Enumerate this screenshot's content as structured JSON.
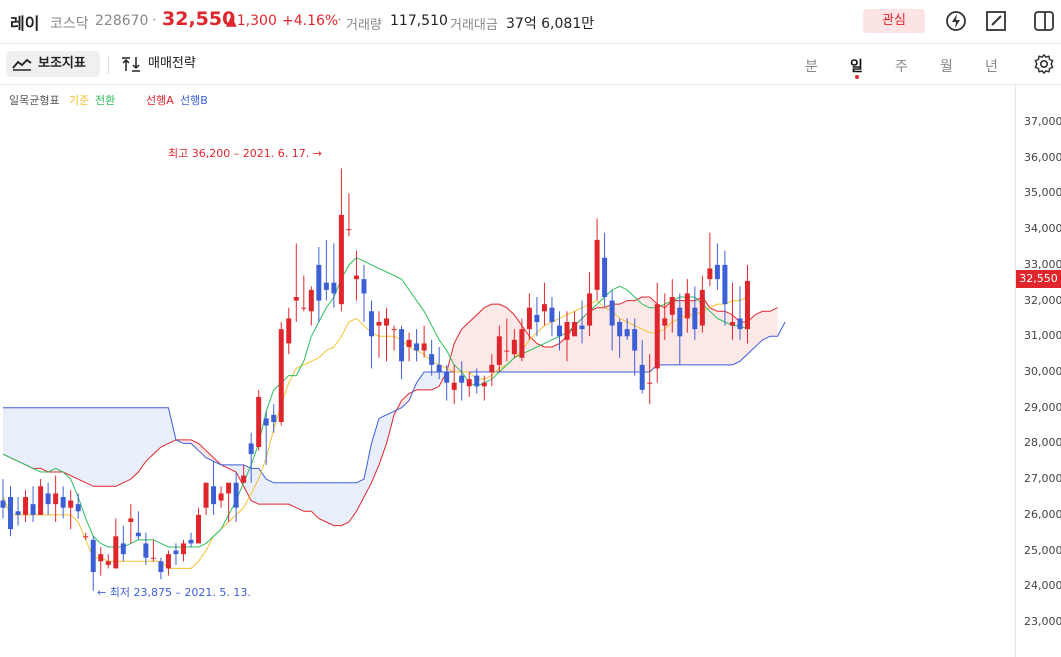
{
  "header": {
    "name": "레이",
    "market": "코스닥",
    "code": "228670",
    "dot": "·",
    "price": "32,550",
    "change": "▲1,300",
    "change_pct": "+4.16%",
    "volume_label": "거래량",
    "volume": "117,510",
    "amount_label": "거래대금",
    "amount": "37억 6,081만",
    "fav_label": "관심",
    "icons": [
      "lightning-icon",
      "edit-icon",
      "panel-icon"
    ]
  },
  "toolbar": {
    "indicator_label": "보조지표",
    "strategy_label": "매매전략",
    "periods": [
      "분",
      "일",
      "주",
      "월",
      "년"
    ],
    "active_period": "일"
  },
  "legend": {
    "title": "일목균형표",
    "base": "기준",
    "conv": "전환",
    "span_a": "선행A",
    "span_b": "선행B"
  },
  "annotations": {
    "high": "최고 36,200 – 2021. 6. 17. →",
    "low": "← 최저 23,875 – 2021. 5. 13."
  },
  "colors": {
    "up": "#e0262d",
    "down": "#3d5fd6",
    "base": "#f2c233",
    "conv": "#2dbf5c",
    "span_a": "#e0262d",
    "span_b": "#3d5fd6",
    "cloud_bull": "#fde8e8",
    "cloud_bear": "#e9eefb"
  },
  "chart_data": {
    "type": "candlestick",
    "indicator": "ichimoku",
    "ylim": [
      22500,
      38000
    ],
    "y_ticks": [
      "37,000",
      "36,000",
      "35,000",
      "34,000",
      "33,000",
      "32,000",
      "31,000",
      "30,000",
      "29,000",
      "28,000",
      "27,000",
      "26,000",
      "25,000",
      "24,000",
      "23,000"
    ],
    "last_price_label": "32,550",
    "candles": [
      [
        26400,
        27000,
        25900,
        26200
      ],
      [
        26500,
        26800,
        25400,
        25600
      ],
      [
        26100,
        26500,
        25700,
        26000
      ],
      [
        26000,
        26700,
        25800,
        26500
      ],
      [
        26300,
        26800,
        25800,
        26000
      ],
      [
        26000,
        27000,
        26000,
        26800
      ],
      [
        26600,
        26900,
        26000,
        26300
      ],
      [
        26300,
        27100,
        25800,
        26600
      ],
      [
        26500,
        26800,
        25900,
        26200
      ],
      [
        26200,
        26700,
        25600,
        26400
      ],
      [
        26300,
        26600,
        25900,
        26100
      ],
      [
        25400,
        25500,
        25300,
        25400
      ],
      [
        25300,
        25400,
        23875,
        24400
      ],
      [
        24700,
        25100,
        24300,
        24900
      ],
      [
        24600,
        24900,
        24500,
        24700
      ],
      [
        24500,
        25900,
        24500,
        25400
      ],
      [
        25200,
        25700,
        24700,
        24900
      ],
      [
        25800,
        26300,
        25200,
        25900
      ],
      [
        25500,
        26100,
        25300,
        25400
      ],
      [
        25200,
        25500,
        24600,
        24800
      ],
      [
        24800,
        25300,
        24700,
        24800
      ],
      [
        24700,
        24800,
        24200,
        24400
      ],
      [
        24500,
        25000,
        24300,
        24900
      ],
      [
        25000,
        25200,
        24600,
        24900
      ],
      [
        24900,
        25300,
        24700,
        25200
      ],
      [
        25300,
        25500,
        25100,
        25200
      ],
      [
        25200,
        26200,
        25200,
        26000
      ],
      [
        26200,
        26900,
        26000,
        26900
      ],
      [
        26800,
        27500,
        26000,
        26300
      ],
      [
        26400,
        26800,
        26200,
        26600
      ],
      [
        26600,
        26900,
        25800,
        26900
      ],
      [
        26900,
        27200,
        25800,
        26200
      ],
      [
        26900,
        27400,
        26900,
        27100
      ],
      [
        28000,
        28300,
        26900,
        27700
      ],
      [
        27900,
        29500,
        27800,
        29300
      ],
      [
        28700,
        28900,
        27400,
        28500
      ],
      [
        28800,
        29100,
        28300,
        28600
      ],
      [
        28600,
        31400,
        28500,
        31200
      ],
      [
        30800,
        31800,
        30500,
        31500
      ],
      [
        32000,
        33600,
        31400,
        32100
      ],
      [
        31800,
        32700,
        31700,
        31800
      ],
      [
        31700,
        32400,
        31300,
        32300
      ],
      [
        33000,
        33500,
        31400,
        32000
      ],
      [
        32500,
        33700,
        32000,
        32300
      ],
      [
        32500,
        33600,
        31800,
        32200
      ],
      [
        31900,
        35700,
        31700,
        34400
      ],
      [
        34000,
        35000,
        33800,
        34000
      ],
      [
        32600,
        33400,
        32000,
        32700
      ],
      [
        32600,
        33000,
        31400,
        32200
      ],
      [
        31700,
        32000,
        30100,
        31000
      ],
      [
        31300,
        31700,
        30400,
        31400
      ],
      [
        31300,
        31800,
        30300,
        31500
      ],
      [
        31200,
        31300,
        30600,
        31200
      ],
      [
        31200,
        31300,
        29800,
        30300
      ],
      [
        30700,
        31100,
        30300,
        30900
      ],
      [
        30800,
        31200,
        30300,
        30600
      ],
      [
        30600,
        31300,
        30400,
        30800
      ],
      [
        30500,
        30900,
        29900,
        30200
      ],
      [
        30200,
        30700,
        29800,
        30000
      ],
      [
        30000,
        30200,
        29200,
        29700
      ],
      [
        29500,
        30200,
        29100,
        29700
      ],
      [
        29900,
        30300,
        29200,
        29700
      ],
      [
        29600,
        30000,
        29300,
        29800
      ],
      [
        29900,
        30100,
        29400,
        29600
      ],
      [
        29600,
        29900,
        29200,
        29700
      ],
      [
        30000,
        30500,
        29600,
        30200
      ],
      [
        30200,
        31300,
        30000,
        31000
      ],
      [
        30600,
        31500,
        30300,
        30600
      ],
      [
        30500,
        31200,
        30400,
        30900
      ],
      [
        30400,
        31500,
        30300,
        31200
      ],
      [
        31200,
        32200,
        30900,
        31800
      ],
      [
        31600,
        32100,
        31000,
        31400
      ],
      [
        31700,
        32500,
        31300,
        31900
      ],
      [
        31800,
        32100,
        31000,
        31400
      ],
      [
        31300,
        31700,
        30600,
        31000
      ],
      [
        30900,
        31700,
        30300,
        31400
      ],
      [
        31000,
        31700,
        31000,
        31400
      ],
      [
        31300,
        32000,
        30800,
        31200
      ],
      [
        31300,
        32800,
        31000,
        32200
      ],
      [
        32300,
        34300,
        32000,
        33700
      ],
      [
        33200,
        33900,
        31800,
        32100
      ],
      [
        32000,
        32300,
        30600,
        31300
      ],
      [
        31400,
        31500,
        30400,
        31000
      ],
      [
        31200,
        31500,
        30900,
        31000
      ],
      [
        31200,
        31500,
        29900,
        30600
      ],
      [
        30200,
        30900,
        29400,
        29500
      ],
      [
        29700,
        30500,
        29100,
        29700
      ],
      [
        30100,
        32500,
        29700,
        31900
      ],
      [
        31300,
        32200,
        30900,
        31500
      ],
      [
        31600,
        32600,
        31100,
        32100
      ],
      [
        31800,
        32200,
        30200,
        31000
      ],
      [
        31500,
        32600,
        31100,
        32200
      ],
      [
        31800,
        32400,
        30900,
        31200
      ],
      [
        31300,
        32700,
        31100,
        32300
      ],
      [
        32600,
        33900,
        32400,
        32900
      ],
      [
        33000,
        33600,
        32300,
        32600
      ],
      [
        33000,
        33400,
        31300,
        31900
      ],
      [
        31300,
        32500,
        30900,
        31400
      ],
      [
        31500,
        32400,
        30900,
        31200
      ],
      [
        31200,
        33000,
        30800,
        32550
      ]
    ],
    "kijun": [
      26500,
      26000,
      26000,
      26000,
      26000,
      26000,
      26000,
      26000,
      26000,
      26000,
      25800,
      25300,
      24800,
      24800,
      24700,
      24700,
      24700,
      24700,
      24700,
      24700,
      24700,
      24700,
      24500,
      24500,
      24500,
      24500,
      24700,
      25000,
      25400,
      25600,
      25800,
      26000,
      26200,
      26600,
      27000,
      27600,
      28400,
      29100,
      29700,
      30100,
      30200,
      30300,
      30400,
      30600,
      30700,
      31000,
      31400,
      31500,
      31300,
      31100,
      31000,
      31000,
      31000,
      30900,
      30700,
      30600,
      30500,
      30300,
      30200,
      30100,
      30000,
      30000,
      30000,
      29800,
      29800,
      29900,
      30100,
      30200,
      30400,
      30600,
      30900,
      31100,
      31300,
      31400,
      31500,
      31600,
      31700,
      31800,
      31900,
      32000,
      31800,
      31700,
      31500,
      31400,
      31300,
      31200,
      31100,
      31100,
      31200,
      31400,
      31500,
      31600,
      31600,
      31700,
      31800,
      31900,
      31900,
      32000,
      32000,
      32100
    ],
    "tenkan": [
      27700,
      27600,
      27500,
      27400,
      27300,
      27200,
      27200,
      27300,
      27200,
      27000,
      26500,
      25900,
      25400,
      25200,
      25100,
      25100,
      25100,
      25200,
      25300,
      25300,
      25300,
      25200,
      25100,
      25100,
      25100,
      25100,
      25100,
      25200,
      25400,
      25600,
      26000,
      26400,
      26900,
      27400,
      28000,
      28900,
      29500,
      29700,
      29900,
      29900,
      30300,
      31000,
      31400,
      31800,
      32100,
      32600,
      33000,
      33200,
      33100,
      33000,
      32900,
      32800,
      32700,
      32600,
      32300,
      32000,
      31700,
      31300,
      30900,
      30600,
      30200,
      30000,
      29700,
      29600,
      29700,
      29800,
      30000,
      30200,
      30400,
      30500,
      30600,
      30700,
      30800,
      30900,
      31000,
      31100,
      31300,
      31500,
      31700,
      31900,
      32100,
      32300,
      32400,
      32300,
      32100,
      31900,
      31800,
      31800,
      31900,
      32000,
      32100,
      32100,
      32100,
      31900,
      31700,
      31500,
      31400,
      31300,
      31300,
      31200
    ],
    "span_a_start": 0,
    "span_a": [
      27700,
      27600,
      27500,
      27400,
      27300,
      27300,
      27200,
      27200,
      27200,
      27100,
      27000,
      26900,
      26800,
      26800,
      26800,
      26800,
      26900,
      27000,
      27200,
      27500,
      27700,
      27900,
      28000,
      28100,
      28100,
      28100,
      28000,
      27800,
      27600,
      27400,
      27300,
      27200,
      26800,
      26400,
      26300,
      26300,
      26300,
      26300,
      26300,
      26200,
      26100,
      26100,
      25900,
      25800,
      25700,
      25700,
      25800,
      26100,
      26500,
      26900,
      27400,
      28000,
      28800,
      29200,
      29400,
      29500,
      29500,
      29500,
      29600,
      30000,
      30800,
      31200,
      31400,
      31600,
      31800,
      31900,
      31900,
      31800,
      31600,
      31300,
      31000,
      30800,
      30700,
      30700,
      30800,
      31000,
      31300,
      31500,
      31700,
      31800,
      31800,
      31900,
      31900,
      32000,
      32000,
      32100,
      32100,
      31900,
      31800,
      32000,
      32000,
      32000,
      32000,
      32100,
      31800,
      31700,
      31700,
      31600,
      31400,
      31400,
      31600,
      31700,
      31700,
      31800
    ],
    "span_b": [
      29000,
      29000,
      29000,
      29000,
      29000,
      29000,
      29000,
      29000,
      29000,
      29000,
      29000,
      29000,
      29000,
      29000,
      29000,
      29000,
      29000,
      29000,
      29000,
      29000,
      29000,
      29000,
      29000,
      28100,
      28000,
      28000,
      27800,
      27600,
      27500,
      27400,
      27400,
      27400,
      27400,
      27300,
      27300,
      27000,
      26900,
      26900,
      26900,
      26900,
      26900,
      26900,
      26900,
      26900,
      26900,
      26900,
      26900,
      26900,
      27000,
      28000,
      28700,
      28800,
      28900,
      29000,
      29200,
      29700,
      30000,
      30000,
      30000,
      30000,
      30000,
      30000,
      30000,
      30000,
      30000,
      30000,
      30000,
      30000,
      30000,
      30000,
      30000,
      30000,
      30000,
      30000,
      30000,
      30000,
      30000,
      30000,
      30000,
      30000,
      30000,
      30000,
      30000,
      30000,
      30000,
      30000,
      30000,
      30200,
      30200,
      30200,
      30200,
      30200,
      30200,
      30200,
      30200,
      30200,
      30200,
      30200,
      30300,
      30500,
      30700,
      30900,
      31000,
      31000,
      31400
    ]
  }
}
